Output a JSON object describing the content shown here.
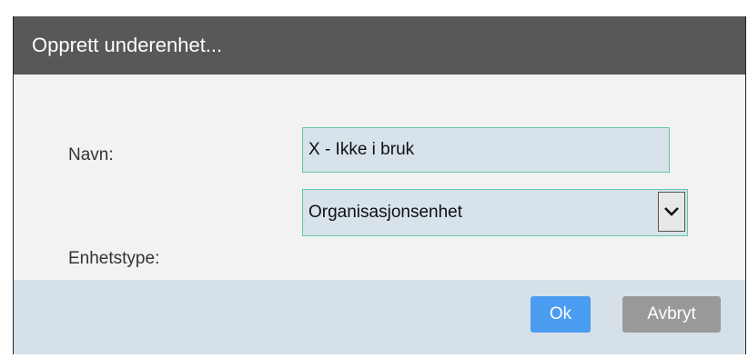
{
  "dialog": {
    "title": "Opprett underenhet...",
    "fields": {
      "name_label": "Navn:",
      "name_value": "X - Ikke i bruk",
      "type_label": "Enhetstype:",
      "type_value": "Organisasjonsenhet"
    },
    "buttons": {
      "ok_label": "Ok",
      "cancel_label": "Avbryt"
    }
  },
  "colors": {
    "titlebar": "#585858",
    "field_border": "#62c8a8",
    "field_bg": "#d7e2ea",
    "ok_button": "#4a9cf0",
    "cancel_button": "#999999",
    "footer_bg": "#d6e0e8"
  },
  "icons": {
    "select_arrow": "chevron-down-icon"
  }
}
